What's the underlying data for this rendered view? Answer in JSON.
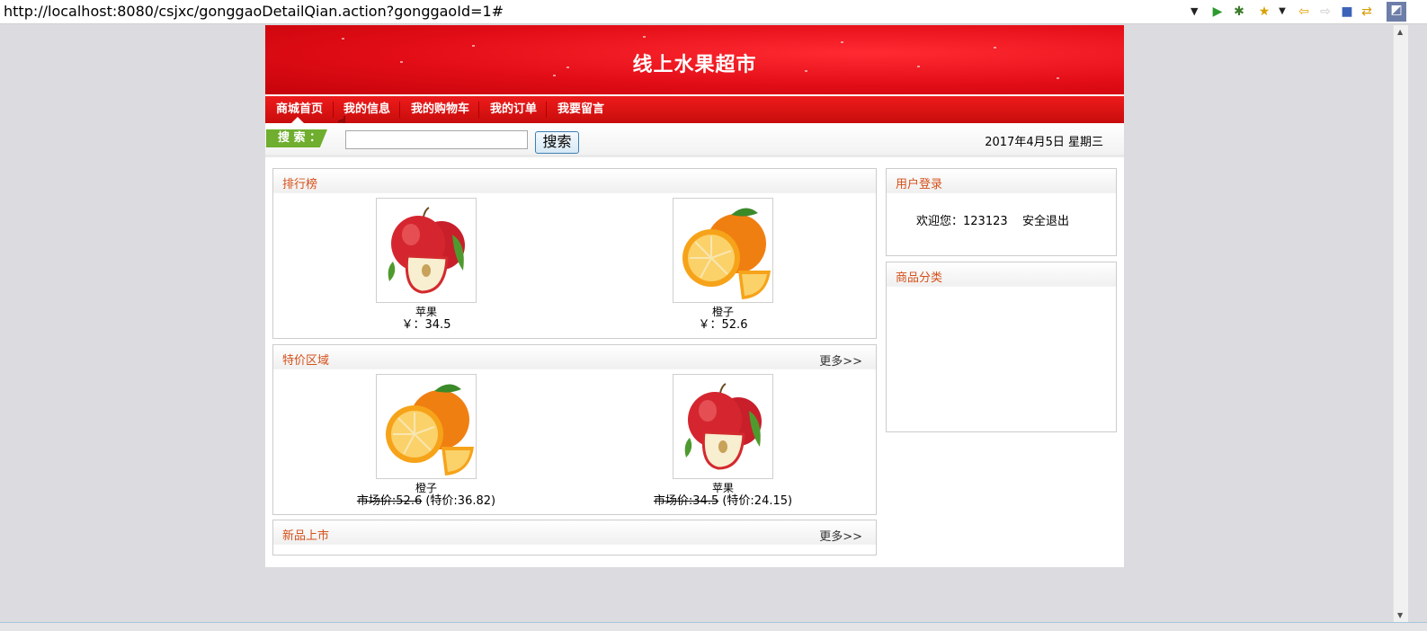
{
  "browser": {
    "url": "http://localhost:8080/csjxc/gonggaoDetailQian.action?gonggaoId=1#",
    "toolbar_icons": [
      "run-icon",
      "debug-icon",
      "bookmark-star-icon",
      "back-arrow-icon",
      "forward-arrow-icon",
      "stop-icon",
      "sync-icon",
      "perspective-icon"
    ]
  },
  "header": {
    "site_title": "线上水果超市"
  },
  "nav": {
    "items": [
      "商城首页",
      "我的信息",
      "我的购物车",
      "我的订单",
      "我要留言"
    ]
  },
  "search": {
    "label": "搜 索 ：",
    "value": "",
    "button": "搜索",
    "date": "2017年4月5日  星期三"
  },
  "ranking": {
    "title": "排行榜",
    "products": [
      {
        "name": "苹果",
        "price": "￥：34.5",
        "image": "apple"
      },
      {
        "name": "橙子",
        "price": "￥：52.6",
        "image": "orange"
      }
    ]
  },
  "special": {
    "title": "特价区域",
    "more": "更多>>",
    "products": [
      {
        "name": "橙子",
        "market_price": "市场价:52.6",
        "special_price": "(特价:36.82)",
        "image": "orange"
      },
      {
        "name": "苹果",
        "market_price": "市场价:34.5",
        "special_price": "(特价:24.15)",
        "image": "apple"
      }
    ]
  },
  "new_arrivals": {
    "title": "新品上市",
    "more": "更多>>"
  },
  "login": {
    "title": "用户登录",
    "welcome": "欢迎您：123123",
    "logout": "安全退出"
  },
  "category": {
    "title": "商品分类"
  }
}
